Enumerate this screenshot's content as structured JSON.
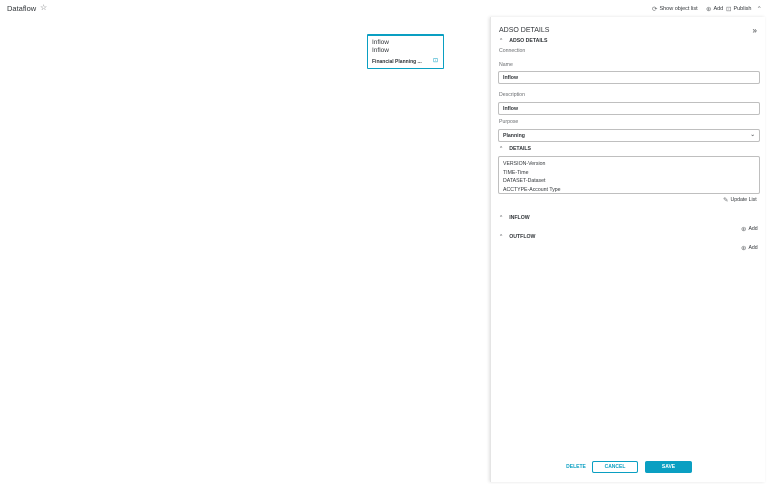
{
  "header": {
    "title": "Dataflow",
    "show_object_list": "Show object list",
    "add": "Add",
    "publish": "Publish"
  },
  "node": {
    "name": "Inflow",
    "description": "Inflow",
    "connection": "Financial Planning ..."
  },
  "panel": {
    "title": "ADSO DETAILS",
    "section_adso": "ADSO DETAILS",
    "connection_label": "Connection",
    "name_label": "Name",
    "name_value": "Inflow",
    "description_label": "Description",
    "description_value": "Inflow",
    "purpose_label": "Purpose",
    "purpose_value": "Planning",
    "section_details": "DETAILS",
    "details_items": [
      "VERSION-Version",
      "TIME-Time",
      "DATASET-Dataset",
      "ACCTYPE-Account Type"
    ],
    "update_list": "Update List",
    "section_inflow": "INFLOW",
    "inflow_add": "Add",
    "section_outflow": "OUTFLOW",
    "outflow_add": "Add",
    "delete": "DELETE",
    "cancel": "CANCEL",
    "save": "SAVE"
  },
  "icons": {
    "star": "star-icon",
    "refresh": "refresh-icon",
    "add": "add-circle-icon",
    "publish": "publish-icon",
    "chevron": "chevron-icon",
    "collapse": "double-chevron-right-icon",
    "edit": "edit-icon"
  },
  "colors": {
    "accent": "#0a9fc2",
    "text": "#32363a"
  }
}
